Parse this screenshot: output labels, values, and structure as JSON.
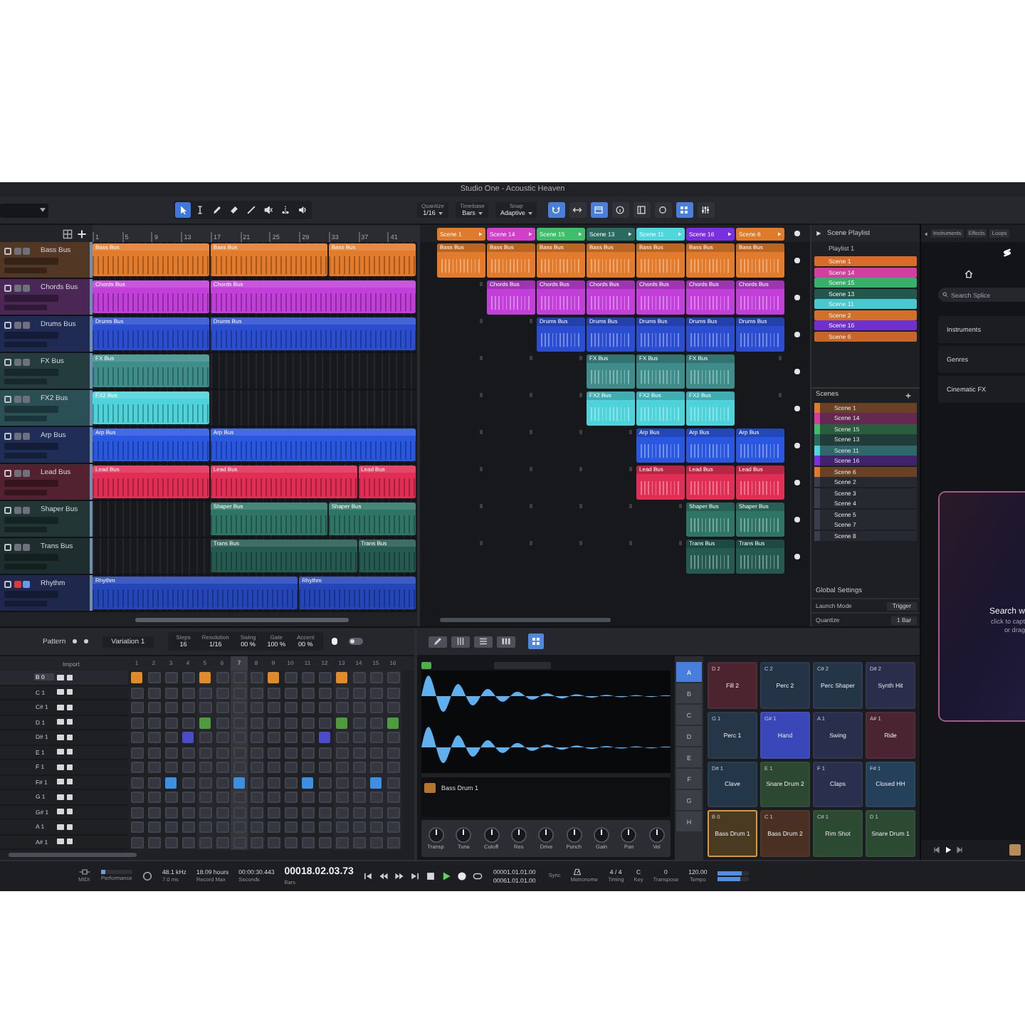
{
  "window": {
    "title": "Studio One - Acoustic Heaven"
  },
  "toolbar": {
    "tools": [
      {
        "kind": "arrow",
        "selected": true
      },
      {
        "kind": "range",
        "selected": false
      },
      {
        "kind": "pencil",
        "selected": false
      },
      {
        "kind": "eraser",
        "selected": false
      },
      {
        "kind": "paint",
        "selected": false
      },
      {
        "kind": "mute",
        "selected": false
      },
      {
        "kind": "split",
        "selected": false
      },
      {
        "kind": "listen",
        "selected": false
      }
    ],
    "selectors": [
      {
        "label": "Quantize",
        "value": "1/16"
      },
      {
        "label": "Timebase",
        "value": "Bars"
      },
      {
        "label": "Snap",
        "value": "Adaptive"
      }
    ],
    "view_buttons": [
      {
        "kind": "snap",
        "selected": true
      },
      {
        "kind": "autoscroll",
        "selected": false
      },
      {
        "kind": "launcher",
        "selected": true
      },
      {
        "kind": "info",
        "selected": false
      },
      {
        "kind": "inspector",
        "selected": false
      },
      {
        "kind": "loop",
        "selected": false
      },
      {
        "kind": "grid",
        "selected": true
      },
      {
        "kind": "mixer",
        "selected": false
      }
    ]
  },
  "ruler": [
    "1",
    "5",
    "9",
    "13",
    "17",
    "21",
    "25",
    "29",
    "33",
    "37",
    "41"
  ],
  "tracks": [
    {
      "name": "Bass Bus",
      "color": "#e27b2c",
      "record_armed": false,
      "monitor": false,
      "lane": [
        {
          "kind": "clip",
          "label": "Bass Bus"
        },
        {
          "kind": "more"
        },
        {
          "kind": "more"
        },
        {
          "kind": "more"
        },
        {
          "kind": "clip",
          "label": "Bass Bus"
        },
        {
          "kind": "more"
        },
        {
          "kind": "more"
        },
        {
          "kind": "more"
        },
        {
          "kind": "clip",
          "label": "Bass Bus"
        },
        {
          "kind": "more"
        },
        {
          "kind": "more"
        }
      ],
      "slots": [
        {
          "kind": "clip",
          "label": "Bass Bus"
        },
        {
          "kind": "clip",
          "label": "Bass Bus"
        },
        {
          "kind": "clip",
          "label": "Bass Bus"
        },
        {
          "kind": "clip",
          "label": "Bass Bus"
        },
        {
          "kind": "clip",
          "label": "Bass Bus"
        },
        {
          "kind": "clip",
          "label": "Bass Bus"
        },
        {
          "kind": "clip",
          "label": "Bass Bus"
        }
      ]
    },
    {
      "name": "Chords Bus",
      "color": "#c23fd9",
      "record_armed": false,
      "monitor": false,
      "lane": [
        {
          "kind": "clip",
          "label": "Chords Bus"
        },
        {
          "kind": "more"
        },
        {
          "kind": "more"
        },
        {
          "kind": "more"
        },
        {
          "kind": "clip",
          "label": "Chords Bus"
        },
        {
          "kind": "more"
        },
        {
          "kind": "more"
        },
        {
          "kind": "more"
        },
        {
          "kind": "more"
        },
        {
          "kind": "more"
        },
        {
          "kind": "more"
        }
      ],
      "slots": [
        {
          "kind": "empty"
        },
        {
          "kind": "clip",
          "label": "Chords Bus"
        },
        {
          "kind": "clip",
          "label": "Chords Bus"
        },
        {
          "kind": "clip",
          "label": "Chords Bus"
        },
        {
          "kind": "clip",
          "label": "Chords Bus"
        },
        {
          "kind": "clip",
          "label": "Chords Bus"
        },
        {
          "kind": "clip",
          "label": "Chords Bus"
        }
      ]
    },
    {
      "name": "Drums Bus",
      "color": "#2b4ed0",
      "record_armed": false,
      "monitor": false,
      "lane": [
        {
          "kind": "clip",
          "label": "Drums Bus"
        },
        {
          "kind": "more"
        },
        {
          "kind": "more"
        },
        {
          "kind": "more"
        },
        {
          "kind": "clip",
          "label": "Drums Bus"
        },
        {
          "kind": "more"
        },
        {
          "kind": "more"
        },
        {
          "kind": "more"
        },
        {
          "kind": "more"
        },
        {
          "kind": "more"
        },
        {
          "kind": "more"
        }
      ],
      "slots": [
        {
          "kind": "empty"
        },
        {
          "kind": "empty"
        },
        {
          "kind": "clip",
          "label": "Drums Bus"
        },
        {
          "kind": "clip",
          "label": "Drums Bus"
        },
        {
          "kind": "clip",
          "label": "Drums Bus"
        },
        {
          "kind": "clip",
          "label": "Drums Bus"
        },
        {
          "kind": "clip",
          "label": "Drums Bus"
        }
      ]
    },
    {
      "name": "FX Bus",
      "color": "#3e8d8b",
      "record_armed": false,
      "monitor": false,
      "lane": [
        {
          "kind": "clip",
          "label": "FX Bus"
        },
        {
          "kind": "more"
        },
        {
          "kind": "more"
        },
        {
          "kind": "more"
        },
        {
          "kind": "empty"
        },
        {
          "kind": "empty"
        },
        {
          "kind": "empty"
        },
        {
          "kind": "empty"
        },
        {
          "kind": "empty"
        },
        {
          "kind": "empty"
        },
        {
          "kind": "empty"
        }
      ],
      "slots": [
        {
          "kind": "empty"
        },
        {
          "kind": "empty"
        },
        {
          "kind": "empty"
        },
        {
          "kind": "clip",
          "label": "FX Bus"
        },
        {
          "kind": "clip",
          "label": "FX Bus"
        },
        {
          "kind": "clip",
          "label": "FX Bus"
        },
        {
          "kind": "empty"
        }
      ]
    },
    {
      "name": "FX2 Bus",
      "color": "#4fd3da",
      "record_armed": false,
      "monitor": false,
      "lane": [
        {
          "kind": "clip",
          "label": "FX2 Bus"
        },
        {
          "kind": "more"
        },
        {
          "kind": "more"
        },
        {
          "kind": "more"
        },
        {
          "kind": "empty"
        },
        {
          "kind": "empty"
        },
        {
          "kind": "empty"
        },
        {
          "kind": "empty"
        },
        {
          "kind": "empty"
        },
        {
          "kind": "empty"
        },
        {
          "kind": "empty"
        }
      ],
      "slots": [
        {
          "kind": "empty"
        },
        {
          "kind": "empty"
        },
        {
          "kind": "empty"
        },
        {
          "kind": "clip",
          "label": "FX2 Bus"
        },
        {
          "kind": "clip",
          "label": "FX2 Bus"
        },
        {
          "kind": "clip",
          "label": "FX2 Bus"
        },
        {
          "kind": "empty"
        }
      ]
    },
    {
      "name": "Arp Bus",
      "color": "#2a57e0",
      "record_armed": false,
      "monitor": false,
      "lane": [
        {
          "kind": "clip",
          "label": "Arp Bus"
        },
        {
          "kind": "more"
        },
        {
          "kind": "more"
        },
        {
          "kind": "more"
        },
        {
          "kind": "clip",
          "label": "Arp Bus"
        },
        {
          "kind": "more"
        },
        {
          "kind": "more"
        },
        {
          "kind": "more"
        },
        {
          "kind": "more"
        },
        {
          "kind": "more"
        },
        {
          "kind": "more"
        }
      ],
      "slots": [
        {
          "kind": "empty"
        },
        {
          "kind": "empty"
        },
        {
          "kind": "empty"
        },
        {
          "kind": "empty"
        },
        {
          "kind": "clip",
          "label": "Arp Bus"
        },
        {
          "kind": "clip",
          "label": "Arp Bus"
        },
        {
          "kind": "clip",
          "label": "Arp Bus"
        }
      ]
    },
    {
      "name": "Lead Bus",
      "color": "#e02e55",
      "record_armed": false,
      "monitor": false,
      "lane": [
        {
          "kind": "clip",
          "label": "Lead Bus"
        },
        {
          "kind": "more"
        },
        {
          "kind": "more"
        },
        {
          "kind": "more"
        },
        {
          "kind": "clip",
          "label": "Lead Bus"
        },
        {
          "kind": "more"
        },
        {
          "kind": "more"
        },
        {
          "kind": "more"
        },
        {
          "kind": "more"
        },
        {
          "kind": "clip",
          "label": "Lead Bus"
        },
        {
          "kind": "more"
        }
      ],
      "slots": [
        {
          "kind": "empty"
        },
        {
          "kind": "empty"
        },
        {
          "kind": "empty"
        },
        {
          "kind": "empty"
        },
        {
          "kind": "clip",
          "label": "Lead Bus"
        },
        {
          "kind": "clip",
          "label": "Lead Bus"
        },
        {
          "kind": "clip",
          "label": "Lead Bus"
        }
      ]
    },
    {
      "name": "Shaper Bus",
      "color": "#2f7566",
      "record_armed": false,
      "monitor": false,
      "lane": [
        {
          "kind": "empty"
        },
        {
          "kind": "empty"
        },
        {
          "kind": "empty"
        },
        {
          "kind": "empty"
        },
        {
          "kind": "clip",
          "label": "Shaper Bus"
        },
        {
          "kind": "more"
        },
        {
          "kind": "more"
        },
        {
          "kind": "more"
        },
        {
          "kind": "clip",
          "label": "Shaper Bus"
        },
        {
          "kind": "more"
        },
        {
          "kind": "more"
        }
      ],
      "slots": [
        {
          "kind": "empty"
        },
        {
          "kind": "empty"
        },
        {
          "kind": "empty"
        },
        {
          "kind": "empty"
        },
        {
          "kind": "empty"
        },
        {
          "kind": "clip",
          "label": "Shaper Bus"
        },
        {
          "kind": "clip",
          "label": "Shaper Bus"
        }
      ]
    },
    {
      "name": "Trans Bus",
      "color": "#245a50",
      "record_armed": false,
      "monitor": false,
      "lane": [
        {
          "kind": "empty"
        },
        {
          "kind": "empty"
        },
        {
          "kind": "empty"
        },
        {
          "kind": "empty"
        },
        {
          "kind": "clip",
          "label": "Trans Bus"
        },
        {
          "kind": "more"
        },
        {
          "kind": "more"
        },
        {
          "kind": "more"
        },
        {
          "kind": "more"
        },
        {
          "kind": "clip",
          "label": "Trans Bus"
        },
        {
          "kind": "more"
        }
      ],
      "slots": [
        {
          "kind": "empty"
        },
        {
          "kind": "empty"
        },
        {
          "kind": "empty"
        },
        {
          "kind": "empty"
        },
        {
          "kind": "empty"
        },
        {
          "kind": "clip",
          "label": "Trans Bus"
        },
        {
          "kind": "clip",
          "label": "Trans Bus"
        }
      ]
    },
    {
      "name": "Rhythm",
      "color": "#2446b8",
      "record_armed": true,
      "monitor": true,
      "lane": [
        {
          "kind": "clip",
          "label": "Rhythm"
        },
        {
          "kind": "more"
        },
        {
          "kind": "more"
        },
        {
          "kind": "more"
        },
        {
          "kind": "more"
        },
        {
          "kind": "more"
        },
        {
          "kind": "more"
        },
        {
          "kind": "clip",
          "label": "Rhythm"
        },
        {
          "kind": "more"
        },
        {
          "kind": "more"
        },
        {
          "kind": "more"
        }
      ]
    }
  ],
  "scenes": [
    {
      "name": "Scene 1",
      "color": "#e07b2c"
    },
    {
      "name": "Scene 14",
      "color": "#d23fc9"
    },
    {
      "name": "Scene 15",
      "color": "#3fbf6b"
    },
    {
      "name": "Scene 13",
      "color": "#2b6a5e"
    },
    {
      "name": "Scene 11",
      "color": "#4fd8dc"
    },
    {
      "name": "Scene 16",
      "color": "#7a2fe0"
    },
    {
      "name": "Scene 6",
      "color": "#e07b2c"
    }
  ],
  "scene_panel": {
    "title": "Scene Playlist",
    "playlist": "Playlist 1",
    "playlist_items": [
      {
        "name": "Scene 1",
        "color": "#d86b2a"
      },
      {
        "name": "Scene 14",
        "color": "#d23f9f"
      },
      {
        "name": "Scene 15",
        "color": "#38b06a"
      },
      {
        "name": "Scene 13",
        "color": "#22574e"
      },
      {
        "name": "Scene 11",
        "color": "#48c9cf"
      },
      {
        "name": "Scene 2",
        "color": "#d0702a"
      },
      {
        "name": "Scene 16",
        "color": "#7030d0"
      },
      {
        "name": "Scene 6",
        "color": "#c8652a"
      }
    ],
    "scenes_title": "Scenes",
    "scenes": [
      {
        "name": "Scene 1",
        "color": "#e07b2c"
      },
      {
        "name": "Scene 14",
        "color": "#d23f9f"
      },
      {
        "name": "Scene 15",
        "color": "#3fbf6b"
      },
      {
        "name": "Scene 13",
        "color": "#2b6a5e"
      },
      {
        "name": "Scene 11",
        "color": "#4fd8dc"
      },
      {
        "name": "Scene 16",
        "color": "#7a2fe0"
      },
      {
        "name": "Scene 6",
        "color": "#e07b2c"
      },
      {
        "name": "Scene 2",
        "color": "#3a3e4a"
      },
      {
        "name": "Scene 3",
        "color": "#3a3e4b"
      },
      {
        "name": "Scene 4",
        "color": "#3a3e4c"
      },
      {
        "name": "Scene 5",
        "color": "#3a3e4d"
      },
      {
        "name": "Scene 7",
        "color": "#3a3e4e"
      },
      {
        "name": "Scene 8",
        "color": "#3a3e4f"
      }
    ],
    "settings_title": "Global Settings",
    "settings": [
      {
        "label": "Launch Mode",
        "value": "Trigger"
      },
      {
        "label": "Quantize",
        "value": "1 Bar"
      }
    ]
  },
  "bottom_toolbar": [
    {
      "kind": "edit",
      "selected": false
    },
    {
      "kind": "mix",
      "selected": false
    },
    {
      "kind": "browse",
      "selected": false
    },
    {
      "kind": "keys",
      "selected": false
    },
    {
      "kind": "pads",
      "selected": true
    }
  ],
  "pattern": {
    "label": "Pattern",
    "variation": "Variation 1",
    "params": [
      {
        "label": "Steps",
        "value": "16"
      },
      {
        "label": "Resolution",
        "value": "1/16"
      },
      {
        "label": "Swing",
        "value": "00 %"
      },
      {
        "label": "Gate",
        "value": "100 %"
      },
      {
        "label": "Accent",
        "value": "00 %"
      }
    ],
    "switch_on": false,
    "column_label": "Import",
    "step_numbers": [
      {
        "label": "1",
        "current": false
      },
      {
        "label": "2",
        "current": false
      },
      {
        "label": "3",
        "current": false
      },
      {
        "label": "4",
        "current": false
      },
      {
        "label": "5",
        "current": false
      },
      {
        "label": "6",
        "current": false
      },
      {
        "label": "7",
        "current": true
      },
      {
        "label": "8",
        "current": false
      },
      {
        "label": "9",
        "current": false
      },
      {
        "label": "10",
        "current": false
      },
      {
        "label": "11",
        "current": false
      },
      {
        "label": "12",
        "current": false
      },
      {
        "label": "13",
        "current": false
      },
      {
        "label": "14",
        "current": false
      },
      {
        "label": "15",
        "current": false
      },
      {
        "label": "16",
        "current": false
      }
    ],
    "rows": [
      {
        "note": "B 0",
        "selected": true,
        "color": "#e08a2a",
        "steps": [
          true,
          false,
          false,
          false,
          true,
          false,
          false,
          false,
          true,
          false,
          false,
          false,
          true,
          false,
          false,
          false
        ]
      },
      {
        "note": "C 1",
        "selected": false,
        "steps": [
          false,
          false,
          false,
          false,
          false,
          false,
          false,
          false,
          false,
          false,
          false,
          false,
          false,
          false,
          false,
          false
        ]
      },
      {
        "note": "C# 1",
        "selected": false,
        "steps": [
          false,
          false,
          false,
          false,
          false,
          false,
          false,
          false,
          false,
          false,
          false,
          false,
          false,
          false,
          false,
          false
        ]
      },
      {
        "note": "D 1",
        "selected": false,
        "color": "#4f9a3c",
        "steps": [
          false,
          false,
          false,
          false,
          true,
          false,
          false,
          false,
          false,
          false,
          false,
          false,
          true,
          false,
          false,
          true
        ]
      },
      {
        "note": "D# 1",
        "selected": false,
        "color": "#4a4cc8",
        "steps": [
          false,
          false,
          false,
          true,
          false,
          false,
          false,
          false,
          false,
          false,
          false,
          true,
          false,
          false,
          false,
          false
        ]
      },
      {
        "note": "E 1",
        "selected": false,
        "steps": [
          false,
          false,
          false,
          false,
          false,
          false,
          false,
          false,
          false,
          false,
          false,
          false,
          false,
          false,
          false,
          false
        ]
      },
      {
        "note": "F 1",
        "selected": false,
        "steps": [
          false,
          false,
          false,
          false,
          false,
          false,
          false,
          false,
          false,
          false,
          false,
          false,
          false,
          false,
          false,
          false
        ]
      },
      {
        "note": "F# 1",
        "selected": false,
        "color": "#3d8fe0",
        "steps": [
          false,
          false,
          true,
          false,
          false,
          false,
          true,
          false,
          false,
          false,
          true,
          false,
          false,
          false,
          true,
          false
        ]
      },
      {
        "note": "G 1",
        "selected": false,
        "steps": [
          false,
          false,
          false,
          false,
          false,
          false,
          false,
          false,
          false,
          false,
          false,
          false,
          false,
          false,
          false,
          false
        ]
      },
      {
        "note": "G# 1",
        "selected": false,
        "steps": [
          false,
          false,
          false,
          false,
          false,
          false,
          false,
          false,
          false,
          false,
          false,
          false,
          false,
          false,
          false,
          false
        ]
      },
      {
        "note": "A 1",
        "selected": false,
        "steps": [
          false,
          false,
          false,
          false,
          false,
          false,
          false,
          false,
          false,
          false,
          false,
          false,
          false,
          false,
          false,
          false
        ]
      },
      {
        "note": "A# 1",
        "selected": false,
        "steps": [
          false,
          false,
          false,
          false,
          false,
          false,
          false,
          false,
          false,
          false,
          false,
          false,
          false,
          false,
          false,
          false
        ]
      }
    ]
  },
  "sampler": {
    "sample_name": "Bass Drum 1",
    "knobs": [
      {
        "label": "Transp"
      },
      {
        "label": "Tune"
      },
      {
        "label": "Cutoff"
      },
      {
        "label": "Res"
      },
      {
        "label": "Drive"
      },
      {
        "label": "Punch"
      },
      {
        "label": "Gain"
      },
      {
        "label": "Pan"
      },
      {
        "label": "Vel"
      }
    ]
  },
  "pads": {
    "banks": [
      {
        "label": "A",
        "selected": true
      },
      {
        "label": "B",
        "selected": false
      },
      {
        "label": "C",
        "selected": false
      },
      {
        "label": "D",
        "selected": false
      },
      {
        "label": "E",
        "selected": false
      },
      {
        "label": "F",
        "selected": false
      },
      {
        "label": "G",
        "selected": false
      },
      {
        "label": "H",
        "selected": false
      }
    ],
    "items": [
      {
        "note": "D 2",
        "name": "Fill 2",
        "color": "#4b2430",
        "selected": false
      },
      {
        "note": "C 2",
        "name": "Perc 2",
        "color": "#243446",
        "selected": false
      },
      {
        "note": "C# 2",
        "name": "Perc Shaper",
        "color": "#253548",
        "selected": false
      },
      {
        "note": "D# 2",
        "name": "Synth Hit",
        "color": "#2a2d4c",
        "selected": false
      },
      {
        "note": "G 1",
        "name": "Perc 1",
        "color": "#243647",
        "selected": false
      },
      {
        "note": "G# 1",
        "name": "Hand",
        "color": "#3a47b8",
        "selected": false
      },
      {
        "note": "A 1",
        "name": "Swing",
        "color": "#2a2e4d",
        "selected": false
      },
      {
        "note": "A# 1",
        "name": "Ride",
        "color": "#4b2431",
        "selected": false
      },
      {
        "note": "D# 1",
        "name": "Clave",
        "color": "#243749",
        "selected": false
      },
      {
        "note": "E 1",
        "name": "Snare Drum 2",
        "color": "#2c4830",
        "selected": false
      },
      {
        "note": "F 1",
        "name": "Claps",
        "color": "#2a2f4e",
        "selected": false
      },
      {
        "note": "F# 1",
        "name": "Closed HH",
        "color": "#24405a",
        "selected": false
      },
      {
        "note": "B 0",
        "name": "Bass Drum 1",
        "color": "#4a3a22",
        "selected": true
      },
      {
        "note": "C 1",
        "name": "Bass Drum 2",
        "color": "#4a3022",
        "selected": false
      },
      {
        "note": "C# 1",
        "name": "Rim Shot",
        "color": "#2c4931",
        "selected": false
      },
      {
        "note": "D 1",
        "name": "Snare Drum 1",
        "color": "#2c4a32",
        "selected": false
      }
    ]
  },
  "browser": {
    "tabs": [
      {
        "label": "Instruments",
        "selected": false
      },
      {
        "label": "Effects",
        "selected": false
      },
      {
        "label": "Loops",
        "selected": false
      }
    ],
    "search_placeholder": "Search Splice",
    "categories": [
      "Instruments",
      "Genres",
      "Cinematic FX"
    ],
    "drop_zone": {
      "title": "Search w",
      "lines": [
        "click to capt",
        "or drag"
      ]
    }
  },
  "transport": {
    "midi_label": "MIDI",
    "performance": {
      "label": "Performance",
      "level": 0.15
    },
    "readouts": [
      {
        "value": "48.1 kHz",
        "label": "7.0 ms"
      },
      {
        "value": "18.09 hours",
        "label": "Record Max"
      },
      {
        "value": "00:00:30.443",
        "label": "Seconds"
      }
    ],
    "position": {
      "value": "00018.02.03.73",
      "label": "Bars"
    },
    "controls": [
      {
        "kind": "return"
      },
      {
        "kind": "rewind"
      },
      {
        "kind": "forward"
      },
      {
        "kind": "end"
      },
      {
        "kind": "stop"
      },
      {
        "kind": "play"
      },
      {
        "kind": "record"
      },
      {
        "kind": "loop"
      }
    ],
    "loop_start": "00001.01.01.00",
    "loop_end": "00061.01.01.00",
    "sync": "Sync",
    "metronome": "Metronome",
    "settings": [
      {
        "value": "4 / 4",
        "label": "Timing"
      },
      {
        "value": "C",
        "label": "Key"
      },
      {
        "value": "0",
        "label": "Transpose"
      },
      {
        "value": "120.00",
        "label": "Tempo"
      }
    ],
    "meters": [
      {
        "level": 0.8
      },
      {
        "level": 0.72
      }
    ]
  }
}
